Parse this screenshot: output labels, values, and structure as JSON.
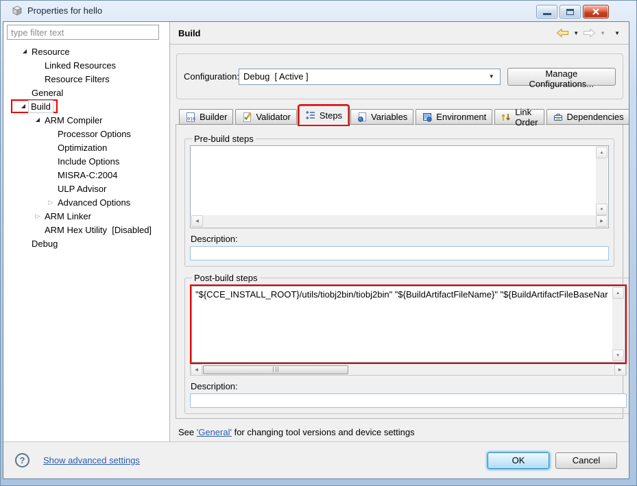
{
  "window": {
    "title": "Properties for hello"
  },
  "sidebar": {
    "filter_placeholder": "type filter text",
    "tree": [
      {
        "label": "Resource",
        "level": 0,
        "state": "expanded"
      },
      {
        "label": "Linked Resources",
        "level": 1,
        "state": "leaf"
      },
      {
        "label": "Resource Filters",
        "level": 1,
        "state": "leaf"
      },
      {
        "label": "General",
        "level": 0,
        "state": "leaf"
      },
      {
        "label": "Build",
        "level": 0,
        "state": "expanded",
        "selected": true,
        "annotated": true
      },
      {
        "label": "ARM Compiler",
        "level": 1,
        "state": "expanded"
      },
      {
        "label": "Processor Options",
        "level": 2,
        "state": "leaf"
      },
      {
        "label": "Optimization",
        "level": 2,
        "state": "leaf"
      },
      {
        "label": "Include Options",
        "level": 2,
        "state": "leaf"
      },
      {
        "label": "MISRA-C:2004",
        "level": 2,
        "state": "leaf"
      },
      {
        "label": "ULP Advisor",
        "level": 2,
        "state": "leaf"
      },
      {
        "label": "Advanced Options",
        "level": 2,
        "state": "collapsed"
      },
      {
        "label": "ARM Linker",
        "level": 1,
        "state": "collapsed"
      },
      {
        "label": "ARM Hex Utility  [Disabled]",
        "level": 1,
        "state": "leaf"
      },
      {
        "label": "Debug",
        "level": 0,
        "state": "leaf"
      }
    ]
  },
  "main": {
    "title": "Build"
  },
  "config": {
    "label": "Configuration:",
    "value": "Debug  [ Active ]",
    "manage": "Manage Configurations..."
  },
  "tabs": [
    {
      "label": "Builder"
    },
    {
      "label": "Validator"
    },
    {
      "label": "Steps",
      "active": true,
      "annotated": true
    },
    {
      "label": "Variables"
    },
    {
      "label": "Environment"
    },
    {
      "label": "Link Order"
    },
    {
      "label": "Dependencies"
    }
  ],
  "prebuild": {
    "legend": "Pre-build steps",
    "text": "",
    "desc_label": "Description:",
    "desc_value": ""
  },
  "postbuild": {
    "legend": "Post-build steps",
    "text": "\"${CCE_INSTALL_ROOT}/utils/tiobj2bin/tiobj2bin\" \"${BuildArtifactFileName}\" \"${BuildArtifactFileBaseNar",
    "desc_label": "Description:",
    "desc_value": ""
  },
  "note": {
    "prefix": "See ",
    "link": "'General'",
    "suffix": " for changing tool versions and device settings"
  },
  "footer": {
    "advanced": "Show advanced settings",
    "ok": "OK",
    "cancel": "Cancel"
  },
  "icons": {
    "expanded": "◢",
    "collapsed": "▷",
    "dropdown": "▼",
    "up": "▲",
    "down": "▼",
    "left": "◀",
    "right": "▶",
    "help": "?"
  },
  "colors": {
    "annotation": "#e60000",
    "link": "#2a5db0",
    "ok_glow": "#7cc5ee"
  }
}
